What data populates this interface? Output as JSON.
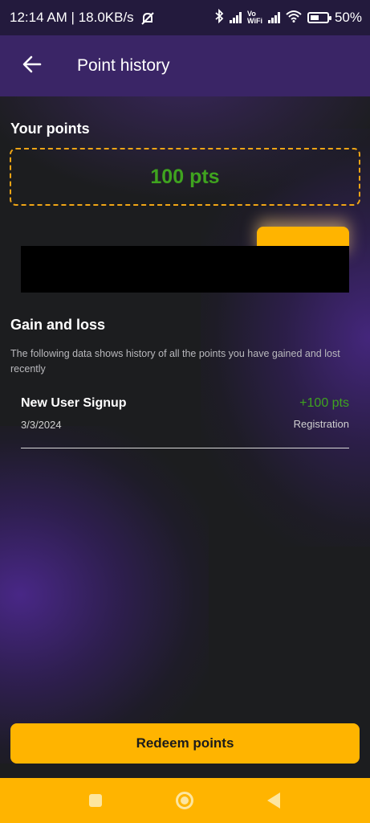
{
  "status_bar": {
    "time_speed": "12:14 AM | 18.0KB/s",
    "volte_label": "Vo",
    "wifi_label": "WiFi",
    "battery": "50%",
    "battery_level": 0.5
  },
  "app_bar": {
    "title": "Point history"
  },
  "points_section": {
    "title": "Your points",
    "value": "100 pts"
  },
  "gain_loss": {
    "title": "Gain and loss",
    "description": "The following data shows history of all the points you have gained and lost recently",
    "items": [
      {
        "title": "New User Signup",
        "date": "3/3/2024",
        "amount": "+100 pts",
        "reason": "Registration"
      }
    ]
  },
  "actions": {
    "redeem_label": "Redeem points"
  },
  "colors": {
    "accent": "#ffb400",
    "gain": "#3fa31f",
    "header": "#3a2566"
  },
  "icons": {
    "back": "arrow-left-icon",
    "nav_recent": "square-icon",
    "nav_home": "circle-icon",
    "nav_back": "triangle-icon"
  }
}
